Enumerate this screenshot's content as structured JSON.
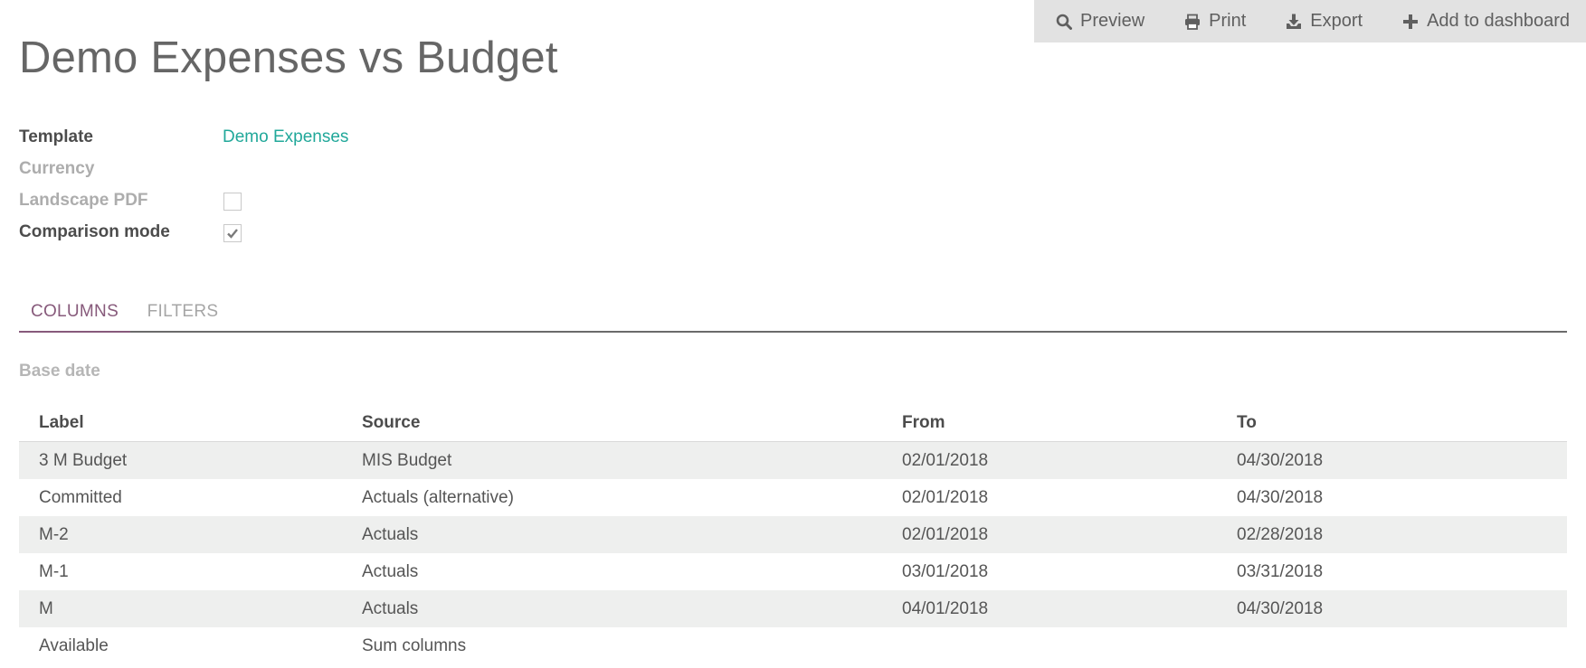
{
  "actions": {
    "preview": "Preview",
    "print": "Print",
    "export": "Export",
    "add_to_dashboard": "Add to dashboard"
  },
  "title": "Demo Expenses vs Budget",
  "fields": {
    "template_label": "Template",
    "template_value": "Demo Expenses",
    "currency_label": "Currency",
    "landscape_label": "Landscape PDF",
    "landscape_checked": false,
    "comparison_label": "Comparison mode",
    "comparison_checked": true
  },
  "tabs": [
    "COLUMNS",
    "FILTERS"
  ],
  "base_date_label": "Base date",
  "table": {
    "headers": [
      "Label",
      "Source",
      "From",
      "To"
    ],
    "rows": [
      [
        "3 M Budget",
        "MIS Budget",
        "02/01/2018",
        "04/30/2018"
      ],
      [
        "Committed",
        "Actuals (alternative)",
        "02/01/2018",
        "04/30/2018"
      ],
      [
        "M-2",
        "Actuals",
        "02/01/2018",
        "02/28/2018"
      ],
      [
        "M-1",
        "Actuals",
        "03/01/2018",
        "03/31/2018"
      ],
      [
        "M",
        "Actuals",
        "04/01/2018",
        "04/30/2018"
      ],
      [
        "Available",
        "Sum columns",
        "",
        ""
      ]
    ]
  },
  "colors": {
    "accent_tab": "#875a7b",
    "link": "#21a89a",
    "stripe": "#eeefee",
    "actionbar": "#e2e2e2"
  }
}
